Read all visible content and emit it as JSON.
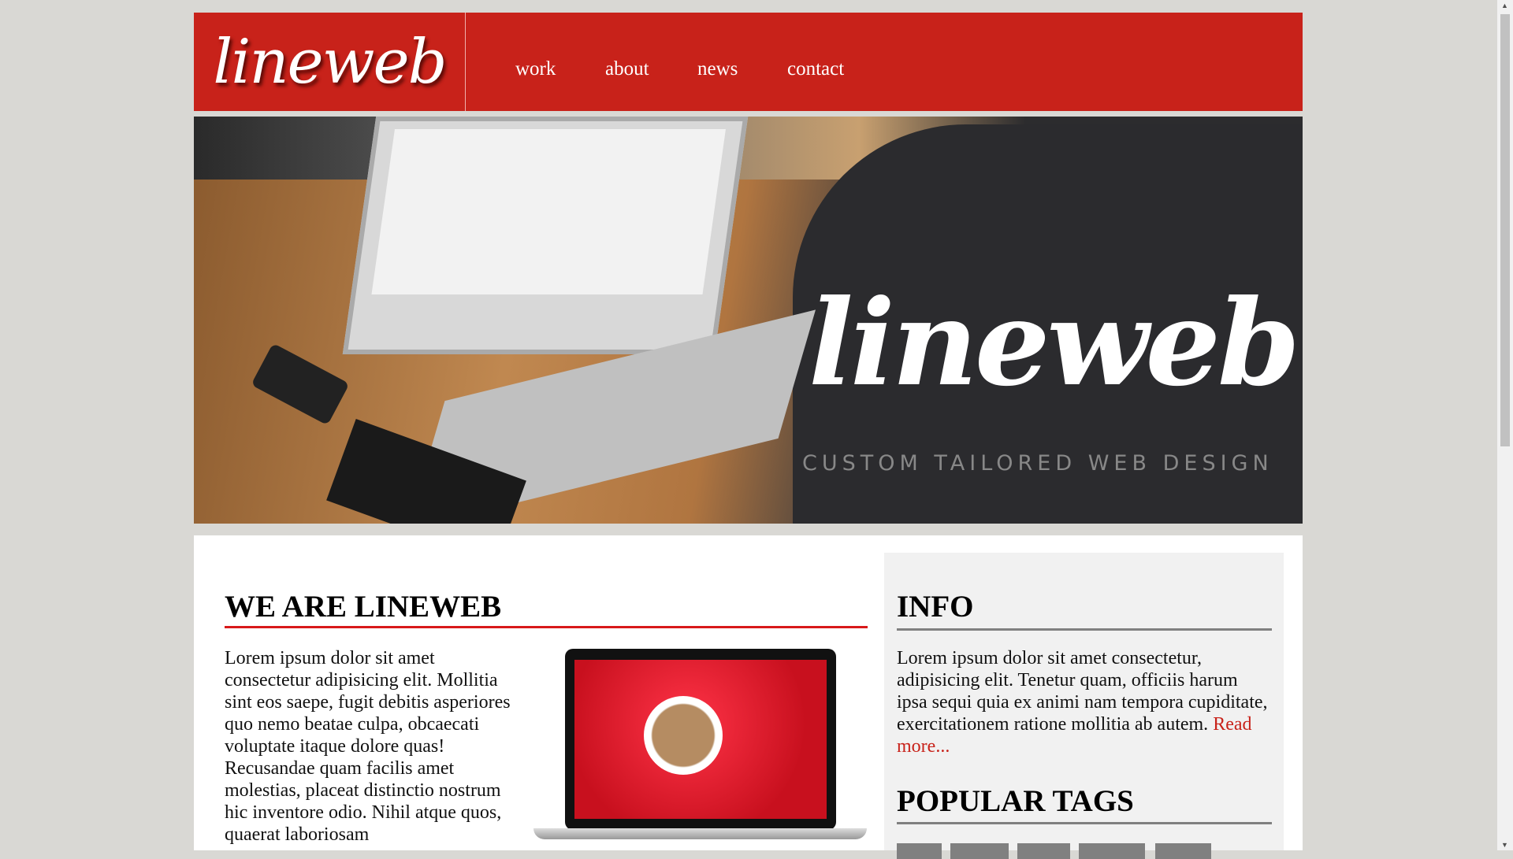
{
  "header": {
    "logo": "lineweb",
    "nav": [
      "work",
      "about",
      "news",
      "contact"
    ]
  },
  "hero": {
    "title": "lineweb",
    "tagline": "CUSTOM TAILORED WEB DESIGN"
  },
  "main": {
    "heading": "WE ARE LINEWEB",
    "body": "Lorem ipsum dolor sit amet consectetur adipisicing elit. Mollitia sint eos saepe, fugit debitis asperiores quo nemo beatae culpa, obcaecati voluptate itaque dolore quas! Recusandae quam facilis amet molestias, placeat distinctio nostrum hic inventore odio. Nihil atque quos, quaerat laboriosam"
  },
  "sidebar": {
    "info_heading": "INFO",
    "info_body": "Lorem ipsum dolor sit amet consectetur, adipisicing elit. Tenetur quam, officiis harum ipsa sequi quia ex animi nam tempora cupiditate, exercitationem ratione mollitia ab autem.",
    "read_more": "Read more...",
    "tags_heading": "POPULAR TAGS"
  },
  "colors": {
    "brand": "#c8221a",
    "accent_line": "#d8191a",
    "sidebar_bg": "#f1f1f1"
  }
}
